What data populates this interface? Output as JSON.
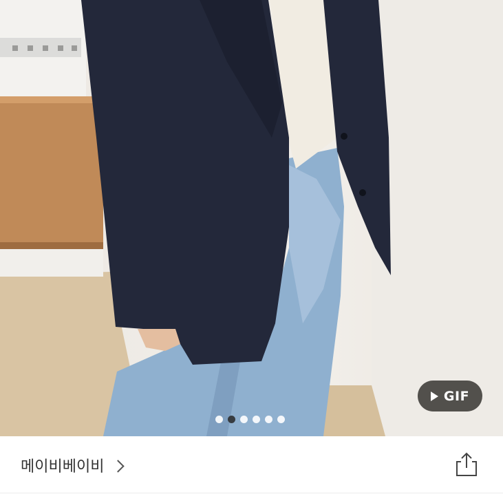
{
  "gallery": {
    "gif_label": "GIF",
    "dot_count": 6,
    "active_index": 1
  },
  "seller": {
    "name": "메이비베이비"
  },
  "icons": {
    "gif_play": "play-icon",
    "seller_arrow": "chevron-right-icon",
    "share": "share-icon"
  },
  "colors": {
    "gif_button_bg": "#302d2a",
    "active_dot": "#282828",
    "inactive_dot": "#ffffff",
    "text": "#333333"
  }
}
